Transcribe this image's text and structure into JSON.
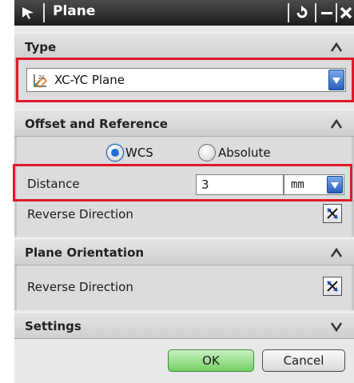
{
  "window": {
    "title": "Plane"
  },
  "sections": {
    "type": {
      "label": "Type",
      "selected": "XC-YC Plane"
    },
    "offset": {
      "label": "Offset and Reference",
      "radio_wcs": "WCS",
      "radio_absolute": "Absolute",
      "selected_radio": "WCS",
      "distance_label": "Distance",
      "distance_value": "3",
      "unit": "mm",
      "reverse_label": "Reverse Direction"
    },
    "orientation": {
      "label": "Plane Orientation",
      "reverse_label": "Reverse Direction"
    },
    "settings": {
      "label": "Settings"
    }
  },
  "buttons": {
    "ok": "OK",
    "cancel": "Cancel"
  },
  "colors": {
    "highlight": "#e0192b",
    "ok_green": "#74d067",
    "titlebar": "#1c1c1c"
  },
  "icons": [
    "select-arrow-icon",
    "reset-icon",
    "minimize-icon",
    "close-icon",
    "chevron-up-icon",
    "chevron-down-icon",
    "xc-yc-plane-icon",
    "reverse-direction-icon"
  ]
}
